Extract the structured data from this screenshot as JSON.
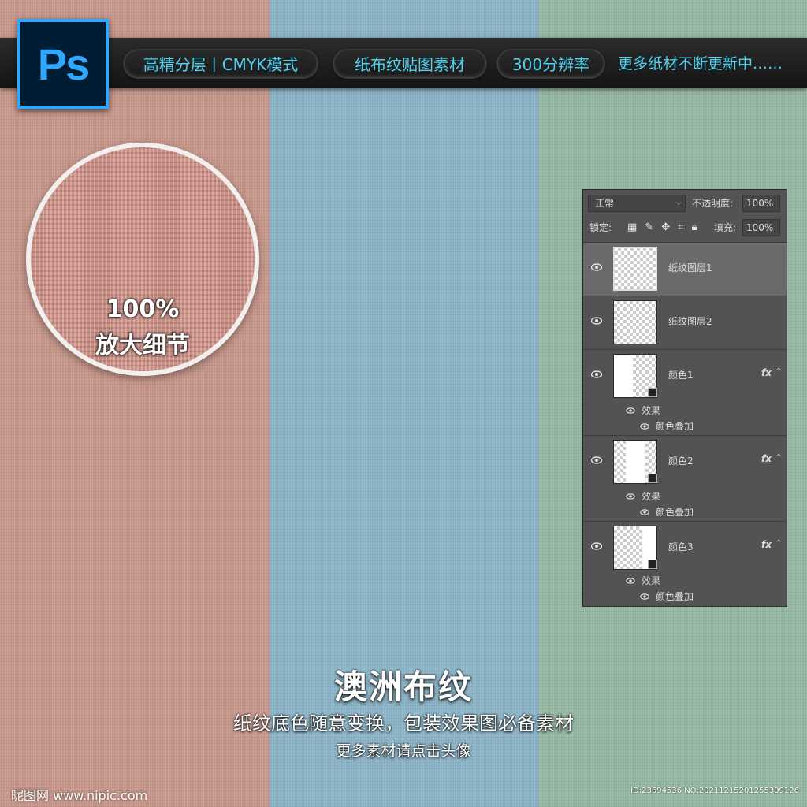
{
  "colors": {
    "stripe_red": "#c6968a",
    "stripe_blue": "#8bb3c6",
    "stripe_green": "#94b7a2",
    "ps_blue": "#31a8ff",
    "pill_text": "#4fd3f0",
    "panel_bg": "#535353"
  },
  "logo": {
    "text": "Ps"
  },
  "topbar": {
    "pills": [
      "高精分层丨CMYK模式",
      "纸布纹贴图素材",
      "300分辨率"
    ],
    "more": "更多纸材不断更新中……"
  },
  "magnifier": {
    "percent": "100%",
    "caption": "放大细节"
  },
  "layers_panel": {
    "blend_mode": "正常",
    "opacity_label": "不透明度:",
    "opacity_value": "100%",
    "lock_label": "锁定:",
    "fill_label": "填充:",
    "fill_value": "100%",
    "layers": [
      {
        "name": "纸纹图层1",
        "selected": true,
        "fx": ""
      },
      {
        "name": "纸纹图层2",
        "selected": false,
        "fx": ""
      },
      {
        "name": "颜色1",
        "selected": false,
        "fx": "fx",
        "effects_label": "效果",
        "effect": "颜色叠加"
      },
      {
        "name": "颜色2",
        "selected": false,
        "fx": "fx",
        "effects_label": "效果",
        "effect": "颜色叠加"
      },
      {
        "name": "颜色3",
        "selected": false,
        "fx": "fx",
        "effects_label": "效果",
        "effect": "颜色叠加"
      }
    ]
  },
  "bottom": {
    "title": "澳洲布纹",
    "subtitle": "纸纹底色随意变换，包装效果图必备素材",
    "hint": "更多素材请点击头像"
  },
  "watermark": {
    "left": "昵图网 www.nipic.com",
    "right": "ID:23694536 NO:20211215201255309126"
  }
}
